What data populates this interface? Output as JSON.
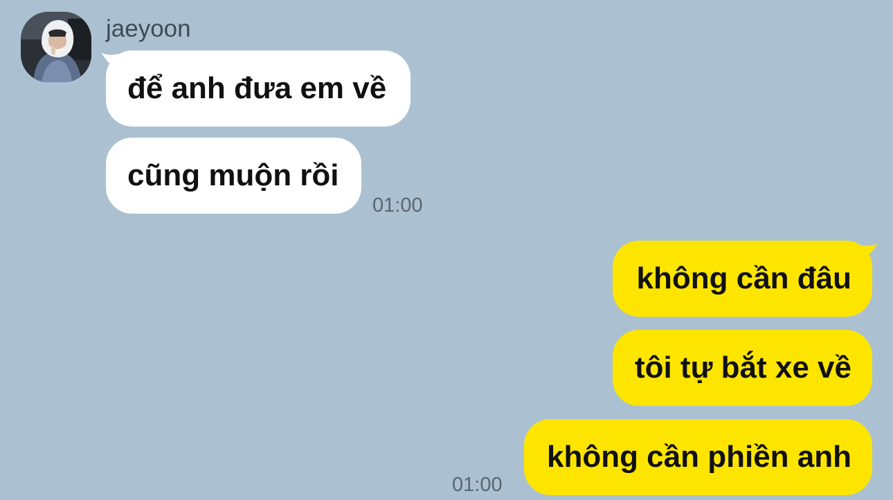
{
  "theme": {
    "background": "#abc1d1",
    "incoming_bubble": "#ffffff",
    "outgoing_bubble": "#fee500"
  },
  "sender": {
    "name": "jaeyoon",
    "avatar_icon": "profile-photo"
  },
  "incoming": {
    "messages": [
      "để anh đưa em về",
      "cũng muộn rồi"
    ],
    "time": "01:00"
  },
  "outgoing": {
    "messages": [
      "không cần đâu",
      "tôi tự bắt xe về",
      "không cần phiền anh"
    ],
    "time": "01:00"
  }
}
